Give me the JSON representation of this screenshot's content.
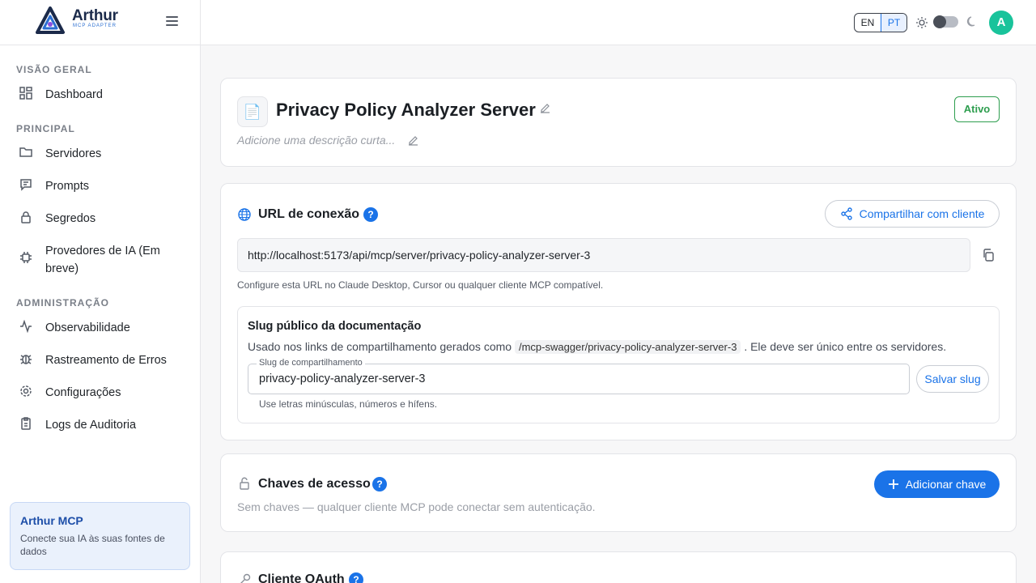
{
  "brand": {
    "name": "Arthur",
    "sub": "MCP ADAPTER"
  },
  "sidebar": {
    "sections": [
      {
        "title": "VISÃO GERAL"
      },
      {
        "title": "PRINCIPAL"
      },
      {
        "title": "ADMINISTRAÇÃO"
      }
    ],
    "items": [
      {
        "label": "Dashboard",
        "icon": "dashboard-icon"
      },
      {
        "label": "Servidores",
        "icon": "folder-icon"
      },
      {
        "label": "Prompts",
        "icon": "message-icon"
      },
      {
        "label": "Segredos",
        "icon": "lock-icon"
      },
      {
        "label": "Provedores de IA (Em breve)",
        "icon": "chip-icon"
      },
      {
        "label": "Observabilidade",
        "icon": "activity-icon"
      },
      {
        "label": "Rastreamento de Erros",
        "icon": "bug-icon"
      },
      {
        "label": "Configurações",
        "icon": "gear-icon"
      },
      {
        "label": "Logs de Auditoria",
        "icon": "clipboard-icon"
      }
    ],
    "card": {
      "title": "Arthur MCP",
      "desc": "Conecte sua IA às suas fontes de dados"
    }
  },
  "topbar": {
    "lang_en": "EN",
    "lang_pt": "PT",
    "avatar": "A"
  },
  "server": {
    "title": "Privacy Policy Analyzer Server",
    "description_placeholder": "Adicione uma descrição curta...",
    "status": "Ativo"
  },
  "connection": {
    "title": "URL de conexão",
    "help": "?",
    "share_label": "Compartilhar com cliente",
    "url": "http://localhost:5173/api/mcp/server/privacy-policy-analyzer-server-3",
    "url_help": "Configure esta URL no Claude Desktop, Cursor ou qualquer cliente MCP compatível.",
    "slug": {
      "title": "Slug público da documentação",
      "desc_before": "Usado nos links de compartilhamento gerados como",
      "desc_code": "/mcp-swagger/privacy-policy-analyzer-server-3",
      "desc_after": ". Ele deve ser único entre os servidores.",
      "field_label": "Slug de compartilhamento",
      "field_value": "privacy-policy-analyzer-server-3",
      "save_label": "Salvar slug",
      "field_help": "Use letras minúsculas, números e hífens."
    }
  },
  "keys": {
    "title": "Chaves de acesso",
    "help": "?",
    "add_label": "Adicionar chave",
    "empty": "Sem chaves — qualquer cliente MCP pode conectar sem autenticação."
  },
  "oauth": {
    "title": "Cliente OAuth",
    "help": "?"
  },
  "colors": {
    "accent": "#1a73e8",
    "success": "#2e9e4f",
    "avatar": "#19c39b"
  }
}
